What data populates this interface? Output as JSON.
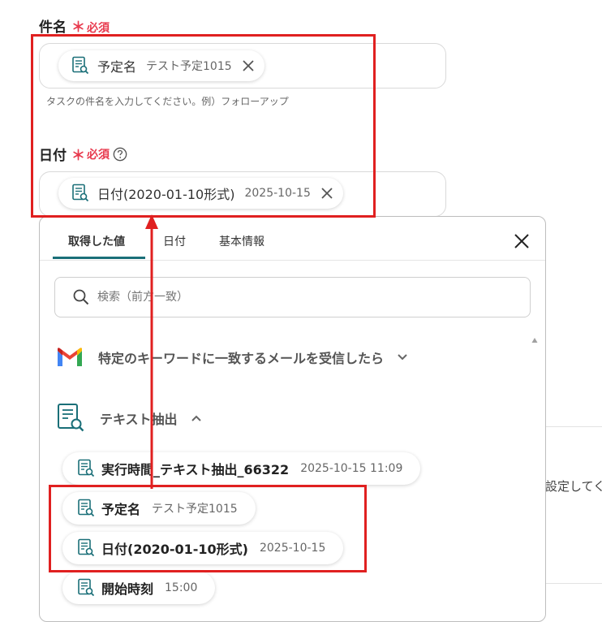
{
  "form": {
    "subject": {
      "label": "件名",
      "required_star": "＊",
      "required_text": "必須",
      "chip_label": "予定名",
      "chip_value": "テスト予定1015",
      "hint": "タスクの件名を入力してください。例）フォローアップ"
    },
    "date": {
      "label": "日付",
      "required_star": "＊",
      "required_text": "必須",
      "chip_label": "日付(2020-01-10形式)",
      "chip_value": "2025-10-15"
    }
  },
  "panel": {
    "tabs": [
      {
        "label": "取得した値",
        "active": true
      },
      {
        "label": "日付",
        "active": false
      },
      {
        "label": "基本情報",
        "active": false
      }
    ],
    "search_placeholder": "検索（前方一致）",
    "sections": [
      {
        "title": "特定のキーワードに一致するメールを受信したら",
        "icon": "gmail-icon",
        "expanded": false
      },
      {
        "title": "テキスト抽出",
        "icon": "text-extract-icon",
        "expanded": true
      }
    ],
    "values": [
      {
        "label": "実行時間_テキスト抽出_66322",
        "value": "2025-10-15 11:09"
      },
      {
        "label": "予定名",
        "value": "テスト予定1015"
      },
      {
        "label": "日付(2020-01-10形式)",
        "value": "2025-10-15"
      },
      {
        "label": "開始時刻",
        "value": "15:00"
      }
    ]
  },
  "background": {
    "partial_text": "設定してく"
  },
  "colors": {
    "required": "#e8394d",
    "highlight": "#e02020",
    "tab_active_underline": "#1a6f78",
    "icon_teal": "#1a6f78"
  }
}
